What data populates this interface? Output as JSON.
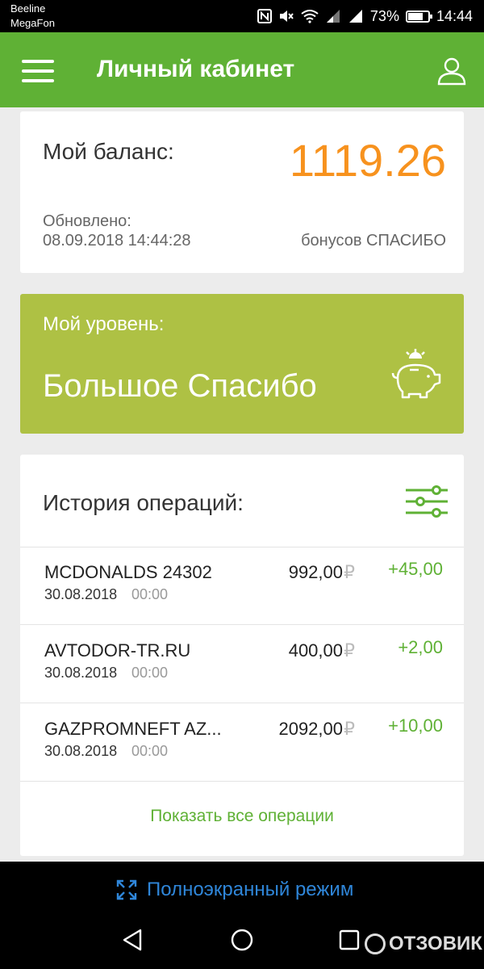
{
  "status_bar": {
    "carrier1": "Beeline",
    "carrier2": "MegaFon",
    "battery_percent": "73%",
    "battery_level": 0.73,
    "time": "14:44",
    "icons": [
      "nfc-icon",
      "mute-icon",
      "wifi-icon",
      "signal-icon",
      "signal-icon",
      "battery-icon"
    ]
  },
  "app_bar": {
    "title": "Личный кабинет",
    "background": "#5fb135"
  },
  "balance": {
    "label": "Мой баланс:",
    "value": "1119.26",
    "updated_label": "Обновлено:",
    "updated_value": "08.09.2018 14:44:28",
    "bonus_label": "бонусов СПАСИБО",
    "value_color": "#f7921e"
  },
  "level": {
    "label": "Мой уровень:",
    "value": "Большое Спасибо",
    "background": "#aec144"
  },
  "history": {
    "title": "История операций:",
    "operations": [
      {
        "name": "MCDONALDS 24302",
        "date": "30.08.2018",
        "time": "00:00",
        "amount": "992,00",
        "currency": "₽",
        "bonus": "+45,00"
      },
      {
        "name": "AVTODOR-TR.RU",
        "date": "30.08.2018",
        "time": "00:00",
        "amount": "400,00",
        "currency": "₽",
        "bonus": "+2,00"
      },
      {
        "name": "GAZPROMNEFT AZ...",
        "date": "30.08.2018",
        "time": "00:00",
        "amount": "2092,00",
        "currency": "₽",
        "bonus": "+10,00"
      }
    ],
    "show_all": "Показать все операции",
    "accent": "#5fb135"
  },
  "bottom": {
    "fullscreen_label": "Полноэкранный режим",
    "fullscreen_color": "#2f86d9",
    "watermark": "ОТЗОВИК"
  }
}
